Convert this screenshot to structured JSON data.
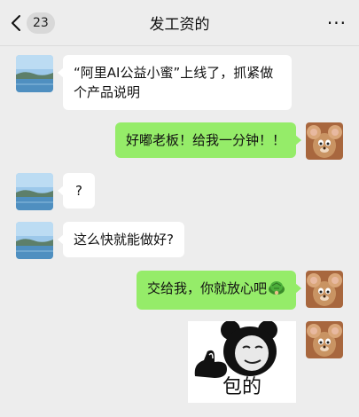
{
  "header": {
    "unread_count": "23",
    "title": "发工资的",
    "more": "···"
  },
  "messages": [
    {
      "side": "left",
      "text": "“阿里AI公益小蜜”上线了，抓紧做个产品说明"
    },
    {
      "side": "right",
      "text": "好嘟老板！给我一分钟！！"
    },
    {
      "side": "left",
      "text": "?"
    },
    {
      "side": "left",
      "text": "这么快就能做好?"
    },
    {
      "side": "right",
      "text": "交给我，你就放心吧",
      "emoji": "turtle-emoji"
    },
    {
      "side": "right",
      "sticker_caption": "包的"
    }
  ],
  "icons": {
    "back": "chevron-left-icon",
    "more": "more-dots-icon",
    "inline_emoji": "turtle-emoji-icon"
  },
  "colors": {
    "background": "#ededed",
    "sent_bubble": "#95ec69",
    "received_bubble": "#ffffff"
  }
}
